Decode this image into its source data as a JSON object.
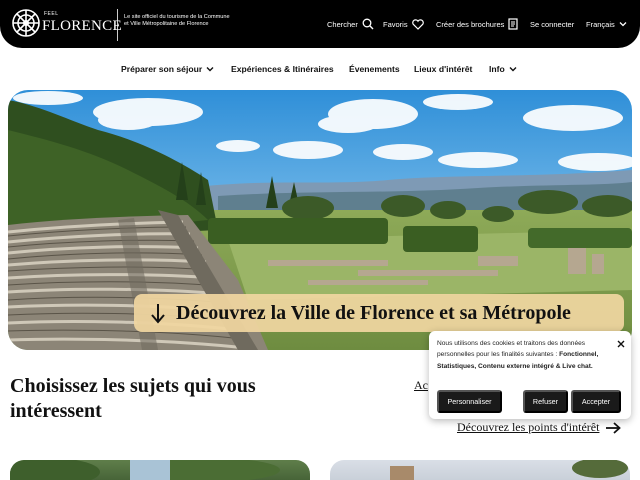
{
  "header": {
    "logo_feel": "FEEL",
    "logo_name": "FLORENCE",
    "tagline": "Le site officiel du tourisme de la Commune et Ville Métropolitaine de Florence",
    "search_label": "Chercher",
    "favorites_label": "Favoris",
    "brochure_label": "Créer des brochures",
    "login_label": "Se connecter",
    "language_label": "Français"
  },
  "nav": {
    "items": [
      {
        "label": "Préparer son séjour",
        "has_dropdown": true
      },
      {
        "label": "Expériences & Itinéraires",
        "has_dropdown": false
      },
      {
        "label": "Évenements",
        "has_dropdown": false
      },
      {
        "label": "Lieux d'intérêt",
        "has_dropdown": false
      },
      {
        "label": "Info",
        "has_dropdown": true
      }
    ]
  },
  "hero": {
    "cta_label": "Découvrez la Ville de Florence et sa Métropole"
  },
  "topics": {
    "title": "Choisissez les sujets qui vous intéressent",
    "partial_link": "Ac",
    "poi_link": "Découvrez les points d'intérêt"
  },
  "cookie": {
    "text_intro": "Nous utilisons des cookies et traitons des données personnelles pour les finalités suivantes :",
    "text_purposes": "Fonctionnel, Statistiques, Contenu externe intégré & Live chat.",
    "customize_label": "Personnaliser",
    "refuse_label": "Refuser",
    "accept_label": "Accepter"
  },
  "icons": {
    "search": "search-icon",
    "favorites": "heart-icon",
    "brochure": "brochure-icon",
    "language": "chevron-down-icon",
    "cta": "arrow-down-icon",
    "poi": "arrow-right-icon",
    "close": "close-icon"
  },
  "colors": {
    "header_bg": "#000000",
    "cta_bg": "#f0d6a0",
    "button_bg": "#1a1a1a"
  }
}
